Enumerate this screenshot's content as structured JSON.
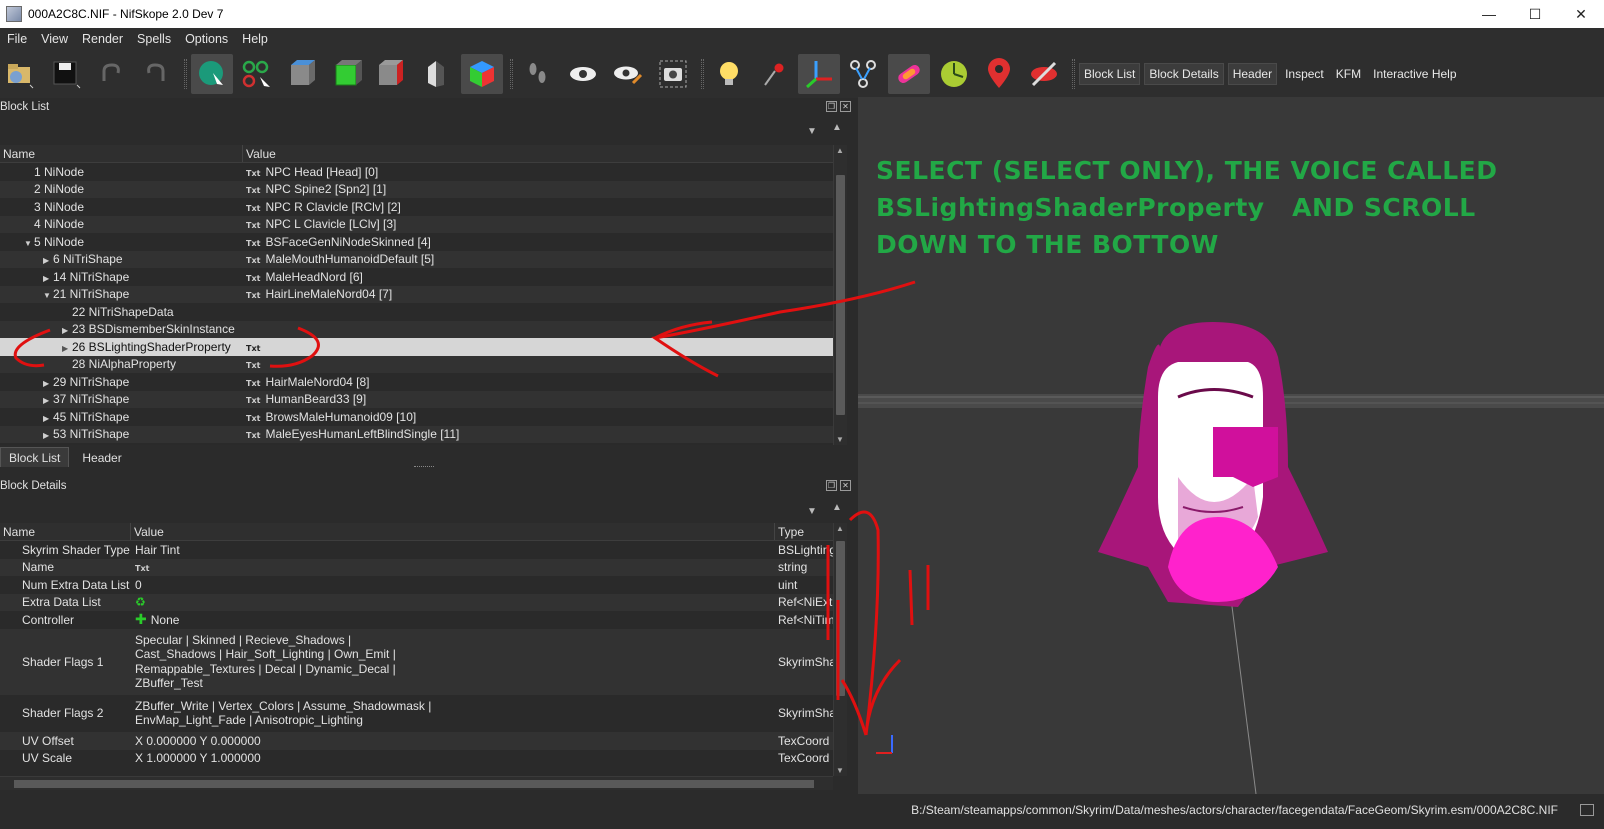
{
  "window": {
    "title": "000A2C8C.NIF - NifSkope 2.0 Dev 7",
    "minimize": "—",
    "maximize": "☐",
    "close": "✕"
  },
  "menu": [
    "File",
    "View",
    "Render",
    "Spells",
    "Options",
    "Help"
  ],
  "toolbar": {
    "text_buttons": [
      "Block List",
      "Block Details",
      "Header",
      "Inspect",
      "KFM",
      "Interactive Help"
    ]
  },
  "block_list": {
    "title": "Block List",
    "columns": [
      "Name",
      "Value"
    ],
    "rows": [
      {
        "name": "1 NiNode",
        "value": "NPC Head [Head] [0]",
        "depth": 0,
        "arrow": "",
        "txt": "Txt"
      },
      {
        "name": "2 NiNode",
        "value": "NPC Spine2 [Spn2] [1]",
        "depth": 0,
        "arrow": "",
        "txt": "Txt"
      },
      {
        "name": "3 NiNode",
        "value": "NPC R Clavicle [RClv] [2]",
        "depth": 0,
        "arrow": "",
        "txt": "Txt"
      },
      {
        "name": "4 NiNode",
        "value": "NPC L Clavicle [LClv] [3]",
        "depth": 0,
        "arrow": "",
        "txt": "Txt"
      },
      {
        "name": "5 NiNode",
        "value": "BSFaceGenNiNodeSkinned [4]",
        "depth": 0,
        "arrow": "▼",
        "txt": "Txt"
      },
      {
        "name": "6 NiTriShape",
        "value": "MaleMouthHumanoidDefault [5]",
        "depth": 1,
        "arrow": "▶",
        "txt": "Txt"
      },
      {
        "name": "14 NiTriShape",
        "value": "MaleHeadNord [6]",
        "depth": 1,
        "arrow": "▶",
        "txt": "Txt"
      },
      {
        "name": "21 NiTriShape",
        "value": "HairLineMaleNord04 [7]",
        "depth": 1,
        "arrow": "▼",
        "txt": "Txt"
      },
      {
        "name": "22 NiTriShapeData",
        "value": "",
        "depth": 2,
        "arrow": "",
        "txt": ""
      },
      {
        "name": "23 BSDismemberSkinInstance",
        "value": "",
        "depth": 2,
        "arrow": "▶",
        "txt": ""
      },
      {
        "name": "26 BSLightingShaderProperty",
        "value": "",
        "depth": 2,
        "arrow": "▶",
        "txt": "Txt",
        "selected": true
      },
      {
        "name": "28 NiAlphaProperty",
        "value": "",
        "depth": 2,
        "arrow": "",
        "txt": "Txt"
      },
      {
        "name": "29 NiTriShape",
        "value": "HairMaleNord04 [8]",
        "depth": 1,
        "arrow": "▶",
        "txt": "Txt"
      },
      {
        "name": "37 NiTriShape",
        "value": "HumanBeard33 [9]",
        "depth": 1,
        "arrow": "▶",
        "txt": "Txt"
      },
      {
        "name": "45 NiTriShape",
        "value": "BrowsMaleHumanoid09 [10]",
        "depth": 1,
        "arrow": "▶",
        "txt": "Txt"
      },
      {
        "name": "53 NiTriShape",
        "value": "MaleEyesHumanLeftBlindSingle [11]",
        "depth": 1,
        "arrow": "▶",
        "txt": "Txt"
      }
    ],
    "tabs": [
      "Block List",
      "Header"
    ]
  },
  "block_details": {
    "title": "Block Details",
    "columns": [
      "Name",
      "Value",
      "Type"
    ],
    "rows": [
      {
        "name": "Skyrim Shader Type",
        "value": "Hair Tint",
        "type": "BSLighting",
        "icon": ""
      },
      {
        "name": "Name",
        "value": "",
        "type": "string",
        "icon": "txt"
      },
      {
        "name": "Num Extra Data List",
        "value": "0",
        "type": "uint",
        "icon": ""
      },
      {
        "name": "Extra Data List",
        "value": "",
        "type": "Ref<NiExtr",
        "icon": "recycle"
      },
      {
        "name": "Controller",
        "value": "None",
        "type": "Ref<NiTim",
        "icon": "plus"
      },
      {
        "name": "Shader Flags 1",
        "lines": [
          "Specular | Skinned | Recieve_Shadows |",
          "Cast_Shadows | Hair_Soft_Lighting | Own_Emit |",
          "Remappable_Textures | Decal | Dynamic_Decal |",
          "ZBuffer_Test"
        ],
        "type": "SkyrimSha"
      },
      {
        "name": "Shader Flags 2",
        "lines": [
          "ZBuffer_Write | Vertex_Colors | Assume_Shadowmask |",
          "EnvMap_Light_Fade | Anisotropic_Lighting"
        ],
        "type": "SkyrimSha"
      },
      {
        "name": "UV Offset",
        "value": "X 0.000000 Y 0.000000",
        "type": "TexCoord",
        "icon": ""
      },
      {
        "name": "UV Scale",
        "value": "X 1.000000 Y 1.000000",
        "type": "TexCoord",
        "icon": ""
      }
    ]
  },
  "annotation": {
    "lines": [
      "SELECT (SELECT ONLY), THE VOICE CALLED",
      "BSLightingShaderProperty   AND SCROLL",
      "DOWN TO THE BOTTOW"
    ],
    "color": "#22a846"
  },
  "status": {
    "path": "B:/Steam/steamapps/common/Skyrim/Data/meshes/actors/character/facegendata/FaceGeom/Skyrim.esm/000A2C8C.NIF"
  },
  "colors": {
    "selection": "#d6d6d6",
    "viewport_bg": "#393939",
    "mesh": "#c8168c",
    "ink": "#e01010"
  }
}
